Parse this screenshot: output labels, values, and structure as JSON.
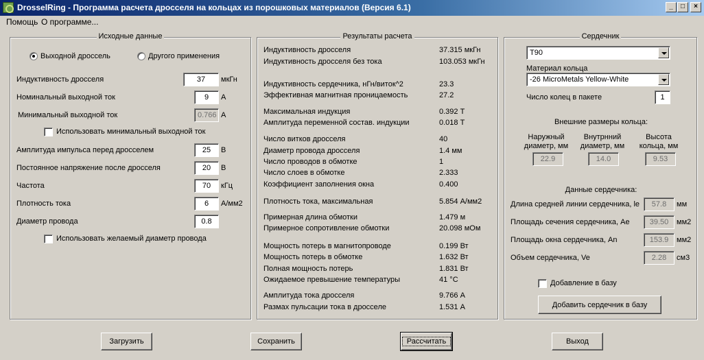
{
  "window": {
    "title": "DrosselRing - Программа расчета дросселя на кольцах из порошковых материалов (Версия 6.1)",
    "minimize": "_",
    "maximize": "□",
    "close": "×"
  },
  "menu": {
    "help": "Помощь",
    "about": "О программе..."
  },
  "input": {
    "title": "Исходные данные",
    "radio_output": "Выходной дроссель",
    "radio_other": "Другого применения",
    "inductance_label": "Индуктивность  дросселя",
    "inductance_value": "37",
    "inductance_unit": "мкГн",
    "nominal_current_label": "Номинальный выходной ток",
    "nominal_current_value": "9",
    "nominal_current_unit": "А",
    "min_current_label": "Минимальный выходной ток",
    "min_current_value": "0.766",
    "min_current_unit": "А",
    "use_min_current_label": "Использовать минимальный выходной ток",
    "pulse_amp_label": "Амплитуда импульса перед дросселем",
    "pulse_amp_value": "25",
    "pulse_amp_unit": "В",
    "dc_voltage_label": "Постоянное напряжение после дросселя",
    "dc_voltage_value": "20",
    "dc_voltage_unit": "В",
    "frequency_label": "Частота",
    "frequency_value": "70",
    "frequency_unit": "кГц",
    "current_density_label": "Плотность тока",
    "current_density_value": "6",
    "current_density_unit": "А/мм2",
    "wire_diameter_label": "Диаметр провода",
    "wire_diameter_value": "0.8",
    "use_wire_diameter_label": "Использовать желаемый диаметр провода"
  },
  "results": {
    "title": "Результаты расчета",
    "rows": [
      {
        "label": "Индуктивность дросселя",
        "value": "37.315 мкГн"
      },
      {
        "label": "Индуктивность дросселя без тока",
        "value": "103.053 мкГн"
      },
      {
        "label": "Индуктивность сердечника, нГн/виток^2",
        "value": "23.3"
      },
      {
        "label": "Эффективная магнитная проницаемость",
        "value": "27.2"
      },
      {
        "label": "Максимальная индукция",
        "value": "0.392 Т"
      },
      {
        "label": "Амплитуда переменной состав. индукции",
        "value": "0.018 Т"
      },
      {
        "label": "Число витков дросселя",
        "value": "40"
      },
      {
        "label": "Диаметр провода дросселя",
        "value": "1.4 мм"
      },
      {
        "label": "Число проводов в обмотке",
        "value": "1"
      },
      {
        "label": "Число слоев в обмотке",
        "value": "2.333"
      },
      {
        "label": "Коэффициент заполнения окна",
        "value": "0.400"
      },
      {
        "label": "Плотность тока, максимальная",
        "value": "5.854 А/мм2"
      },
      {
        "label": "Примерная длина обмотки",
        "value": "1.479 м"
      },
      {
        "label": "Примерное сопротивление обмотки",
        "value": "20.098 мОм"
      },
      {
        "label": "Мощность потерь в магнитопроводе",
        "value": "0.199 Вт"
      },
      {
        "label": "Мощность потерь в обмотке",
        "value": "1.632 Вт"
      },
      {
        "label": "Полная мощность потерь",
        "value": "1.831 Вт"
      },
      {
        "label": "Ожидаемое превышение температуры",
        "value": "41 °C"
      },
      {
        "label": "Амплитуда тока дросселя",
        "value": "9.766 А"
      },
      {
        "label": "Размах пульсации тока в дросселе",
        "value": "1.531 А"
      }
    ]
  },
  "core": {
    "title": "Сердечник",
    "core_select": "T90",
    "material_label": "Материал кольца",
    "material_select": "-26 MicroMetals Yellow-White",
    "rings_label": "Число колец в пакете",
    "rings_value": "1",
    "dims_title": "Внешние размеры кольца:",
    "outer_label": "Наружный\nдиаметр, мм",
    "inner_label": "Внутрнний\nдиаметр, мм",
    "height_label": "Высота\nкольца, мм",
    "outer_value": "22.9",
    "inner_value": "14.0",
    "height_value": "9.53",
    "data_title": "Данные сердечника:",
    "le_label": "Длина средней линии сердечника, le",
    "le_value": "57.8",
    "le_unit": "мм",
    "ae_label": "Площадь сечения сердечника, Ae",
    "ae_value": "39.50",
    "ae_unit": "мм2",
    "an_label": "Площадь окна сердечника, An",
    "an_value": "153.9",
    "an_unit": "мм2",
    "ve_label": "Объем сердечника, Ve",
    "ve_value": "2.28",
    "ve_unit": "см3",
    "add_checkbox_label": "Добавление в базу",
    "add_button": "Добавить сердечник в базу"
  },
  "buttons": {
    "load": "Загрузить",
    "save": "Сохранить",
    "calculate": "Рассчитать",
    "exit": "Выход"
  }
}
